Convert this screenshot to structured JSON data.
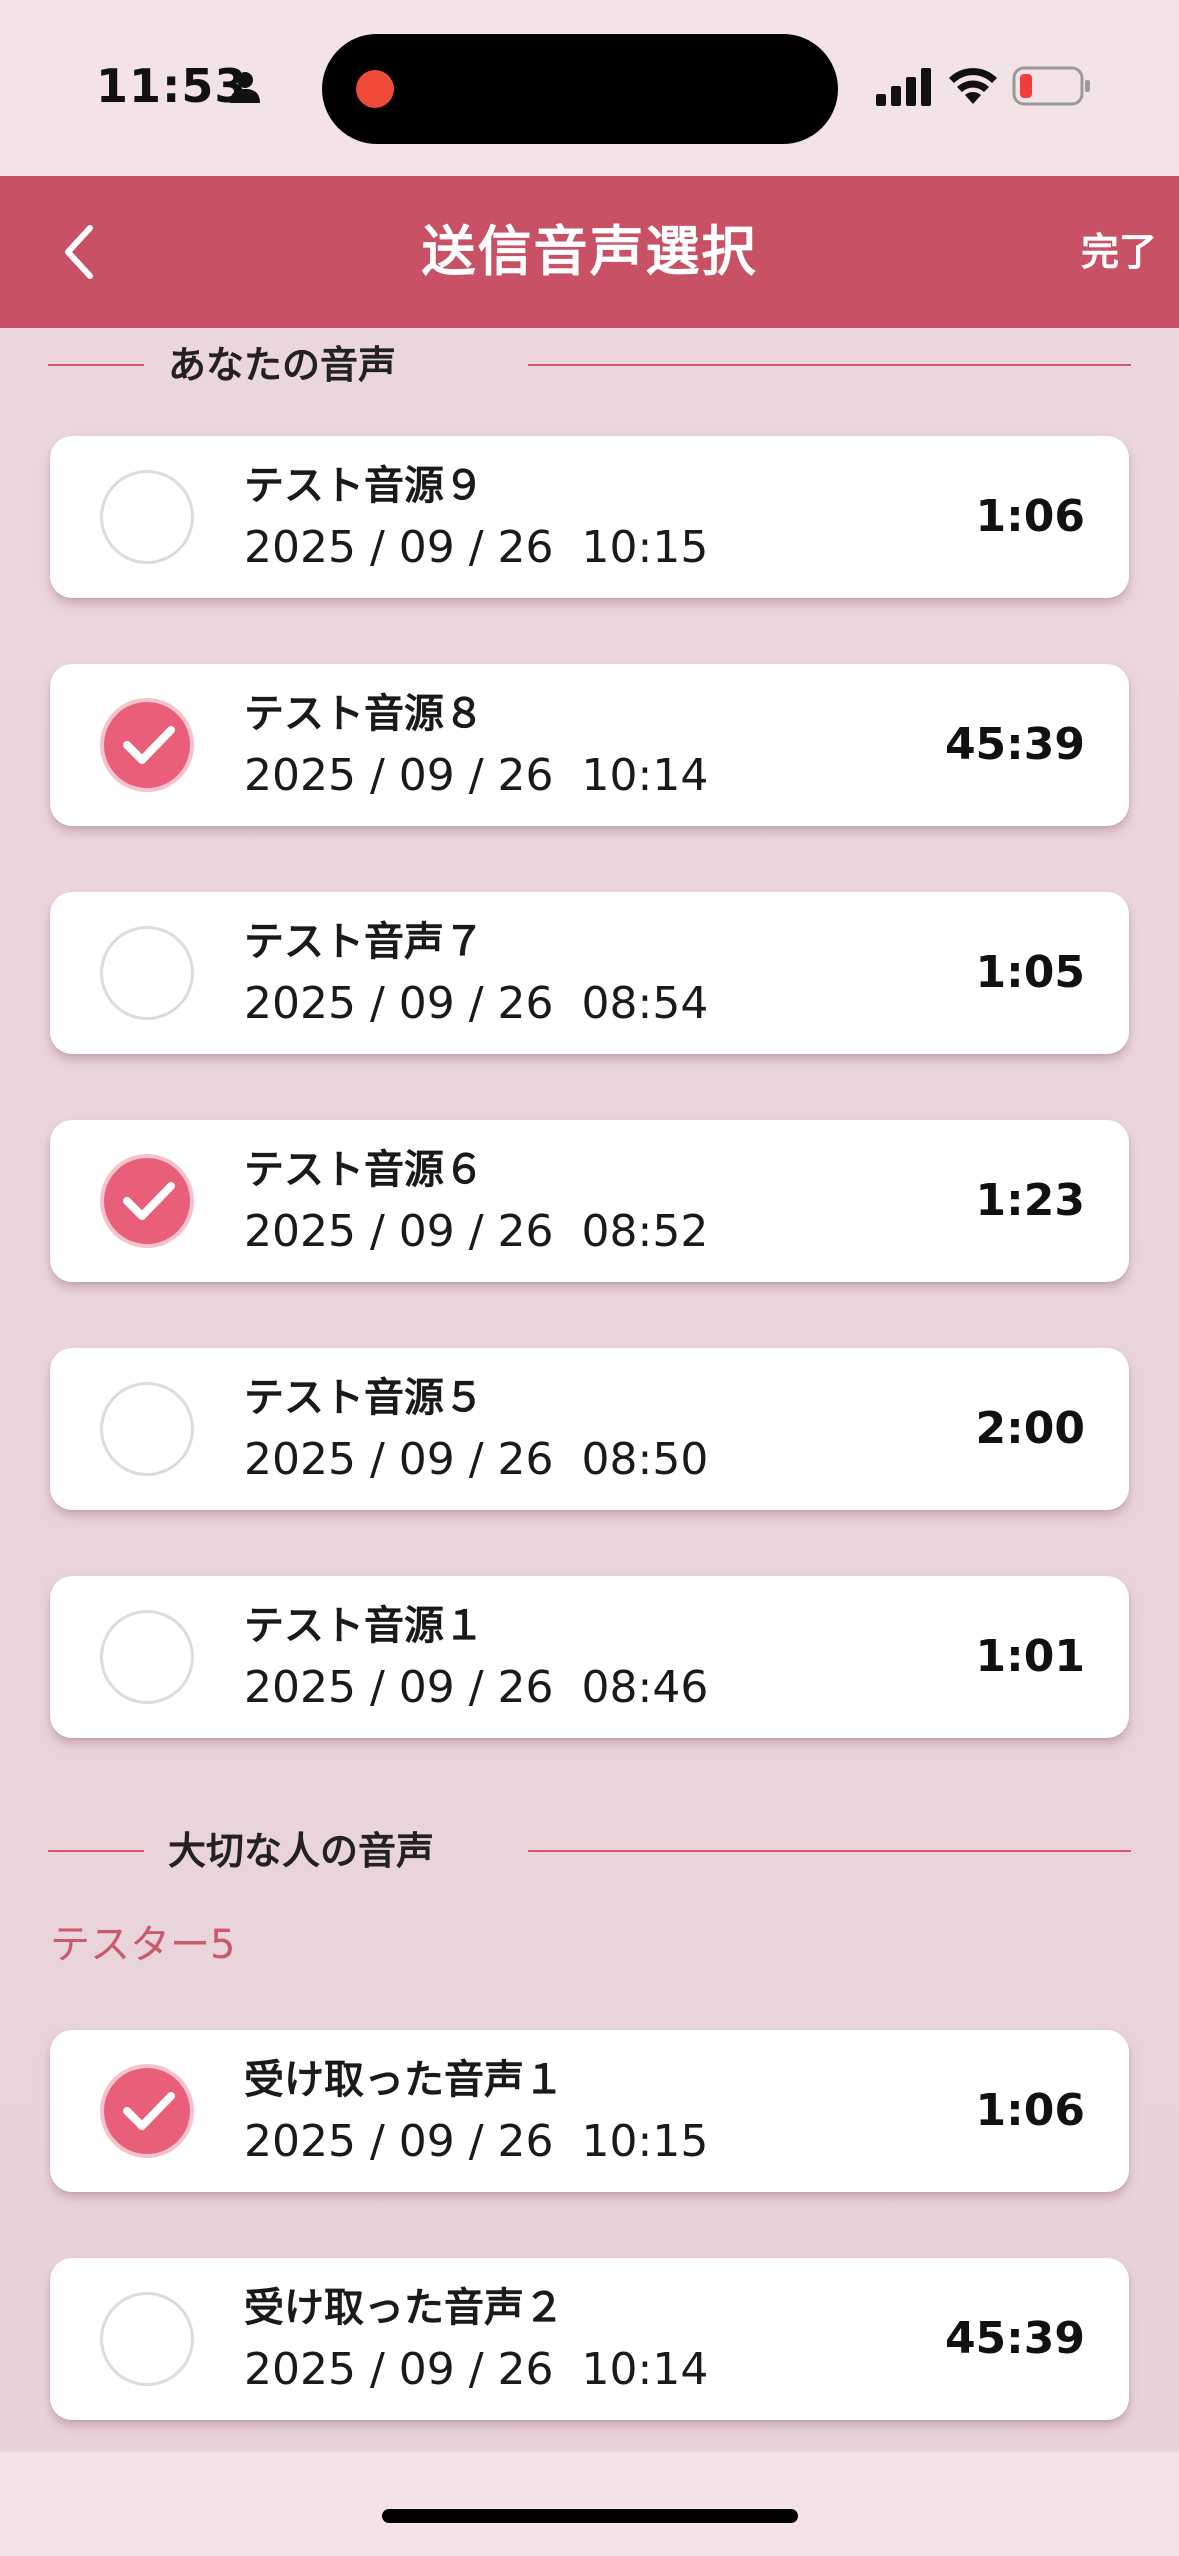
{
  "status_bar": {
    "time": "11:53"
  },
  "nav": {
    "title": "送信音声選択",
    "done_label": "完了"
  },
  "colors": {
    "accent": "#c85165",
    "check_fill": "#e95f79",
    "background": "#ecd6dd"
  },
  "my_section": {
    "title": "あなたの音声",
    "items": [
      {
        "title": "テスト音源９",
        "date": "2025 / 09 / 26  10:15",
        "duration": "1:06",
        "checked": false
      },
      {
        "title": "テスト音源８",
        "date": "2025 / 09 / 26  10:14",
        "duration": "45:39",
        "checked": true
      },
      {
        "title": "テスト音声７",
        "date": "2025 / 09 / 26  08:54",
        "duration": "1:05",
        "checked": false
      },
      {
        "title": "テスト音源６",
        "date": "2025 / 09 / 26  08:52",
        "duration": "1:23",
        "checked": true
      },
      {
        "title": "テスト音源５",
        "date": "2025 / 09 / 26  08:50",
        "duration": "2:00",
        "checked": false
      },
      {
        "title": "テスト音源１",
        "date": "2025 / 09 / 26  08:46",
        "duration": "1:01",
        "checked": false
      }
    ]
  },
  "important_section": {
    "title": "大切な人の音声",
    "sender": "テスター5",
    "items": [
      {
        "title": "受け取った音声１",
        "date": "2025 / 09 / 26  10:15",
        "duration": "1:06",
        "checked": true
      },
      {
        "title": "受け取った音声２",
        "date": "2025 / 09 / 26  10:14",
        "duration": "45:39",
        "checked": false
      }
    ]
  }
}
